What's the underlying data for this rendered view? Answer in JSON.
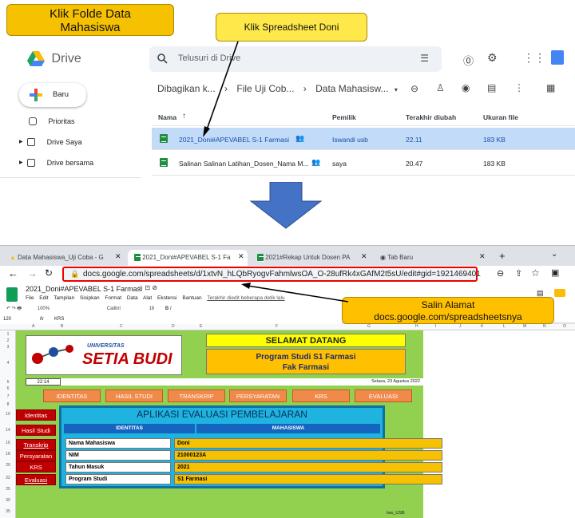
{
  "callouts": {
    "folder": "Klik Folde Data Mahasiswa",
    "spreadsheet": "Klik Spreadsheet Doni",
    "copy_address_line1": "Salin Alamat",
    "copy_address_line2": "docs.google.com/spreadsheetsnya"
  },
  "drive": {
    "logo_text": "Drive",
    "search_placeholder": "Telusuri di Drive",
    "new_button": "Baru",
    "nav": [
      {
        "label": "Prioritas"
      },
      {
        "label": "Drive Saya"
      },
      {
        "label": "Drive bersama"
      }
    ],
    "breadcrumb": [
      "Dibagikan k...",
      "File Uji Cob...",
      "Data Mahasisw..."
    ],
    "columns": {
      "name": "Nama",
      "owner": "Pemilik",
      "modified": "Terakhir diubah",
      "size": "Ukuran file"
    },
    "files": [
      {
        "name": "2021_Doni#APEVABEL S-1 Farmasi",
        "owner": "Iswandi usb",
        "modified": "22.11",
        "size": "183 KB"
      },
      {
        "name": "Salinan Salinan Latihan_Dosen_Nama M...",
        "owner": "saya",
        "modified": "20.47",
        "size": "183 KB"
      }
    ]
  },
  "browser": {
    "tabs": [
      {
        "label": "Data Mahasiswa_Uji Coba - G"
      },
      {
        "label": "2021_Doni#APEVABEL S-1 Fa"
      },
      {
        "label": "2021#Rekap Untuk Dosen PA"
      },
      {
        "label": "Tab Baru"
      }
    ],
    "url": "docs.google.com/spreadsheets/d/1xtvN_hLQbRyogvFahmlwsOA_O-28ufRk4xGAfM2t5sU/edit#gid=1921469401"
  },
  "sheets": {
    "title": "2021_Doni#APEVABEL S-1 Farmasi",
    "menu": [
      "File",
      "Edit",
      "Tampilan",
      "Sisipkan",
      "Format",
      "Data",
      "Alat",
      "Ekstensi",
      "Bantuan"
    ],
    "last_edit": "Terakhir diedit beberapa detik lalu",
    "toolbar_zoom": "100%",
    "toolbar_font": "Calibri",
    "toolbar_size": "16",
    "cell_ref": "120",
    "formula": "KRS",
    "columns": [
      "A",
      "B",
      "C",
      "D",
      "E",
      "F",
      "G",
      "H",
      "I",
      "J",
      "K",
      "L",
      "M",
      "N",
      "O"
    ],
    "row_numbers": [
      "1",
      "2",
      "3",
      "4",
      "5",
      "6",
      "7",
      "8",
      "10",
      "14",
      "16",
      "18",
      "20",
      "22",
      "25",
      "30",
      "35"
    ]
  },
  "app": {
    "uni_line1": "UNIVERSITAS",
    "uni_line2": "SETIA BUDI",
    "welcome": "SELAMAT DATANG",
    "program_line1": "Program Studi S1 Farmasi",
    "program_line2": "Fak Farmasi",
    "time": "22:14",
    "date": "Selasa, 23 Agustus 2022",
    "nav_buttons": [
      "IDENTITAS",
      "HASIL STUDI",
      "TRANSKRIP",
      "PERSYARATAN",
      "KRS",
      "EVALUASI"
    ],
    "side_buttons": [
      "Identitas",
      "Hasil Studi",
      "Transkrip",
      "Persyaratan",
      "KRS",
      "Evaluasi"
    ],
    "panel_title": "APLIKASI EVALUASI PEMBELAJARAN",
    "panel_col1": "IDENTITAS",
    "panel_col2": "MAHASISWA",
    "fields": [
      {
        "label": "Nama Mahasiswa",
        "value": "Doni"
      },
      {
        "label": "NIM",
        "value": "21000123A"
      },
      {
        "label": "Tahun Masuk",
        "value": "2021"
      },
      {
        "label": "Program Studi",
        "value": "S1 Farmasi"
      }
    ],
    "footer": "Isw_USB"
  }
}
